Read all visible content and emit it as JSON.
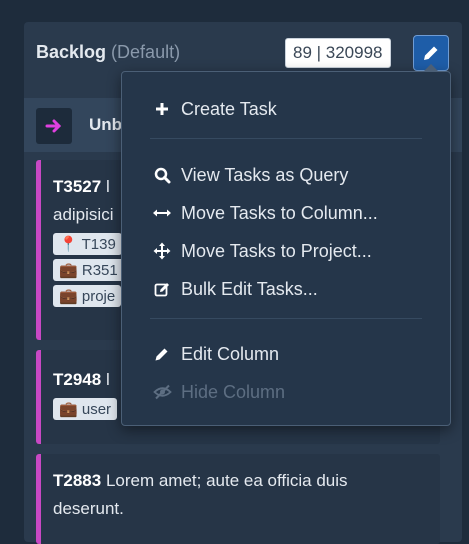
{
  "column": {
    "title": "Backlog",
    "subtitle": "(Default)",
    "count": "89 | 320998",
    "edit_icon": "pencil-icon"
  },
  "lane": {
    "label": "Unb",
    "icon": "arrow-right-icon"
  },
  "cards": [
    {
      "id": "T3527",
      "line1": "l",
      "line2": "adipisici",
      "tags": [
        {
          "icon": "map-pin-icon",
          "text": "T139"
        },
        {
          "icon": "briefcase-icon",
          "text": "R351"
        },
        {
          "icon": "briefcase-icon",
          "text": "proje"
        }
      ]
    },
    {
      "id": "T2948",
      "line1": "l",
      "tags": [
        {
          "icon": "briefcase-icon",
          "text": "user"
        }
      ]
    },
    {
      "id": "T2883",
      "line1": "Lorem amet; aute ea officia duis",
      "line2": "deserunt."
    }
  ],
  "menu": {
    "items": [
      {
        "label": "Create Task",
        "icon": "plus-icon"
      },
      {
        "label": "View Tasks as Query",
        "icon": "search-icon"
      },
      {
        "label": "Move Tasks to Column...",
        "icon": "arrows-horizontal-icon"
      },
      {
        "label": "Move Tasks to Project...",
        "icon": "move-icon"
      },
      {
        "label": "Bulk Edit Tasks...",
        "icon": "edit-square-icon"
      },
      {
        "label": "Edit Column",
        "icon": "pencil-icon"
      },
      {
        "label": "Hide Column",
        "icon": "eye-slash-icon",
        "disabled": true
      }
    ]
  },
  "colors": {
    "accent": "#c848c4",
    "edit_button": "#1e5da8",
    "lane_arrow": "#e040e0"
  }
}
